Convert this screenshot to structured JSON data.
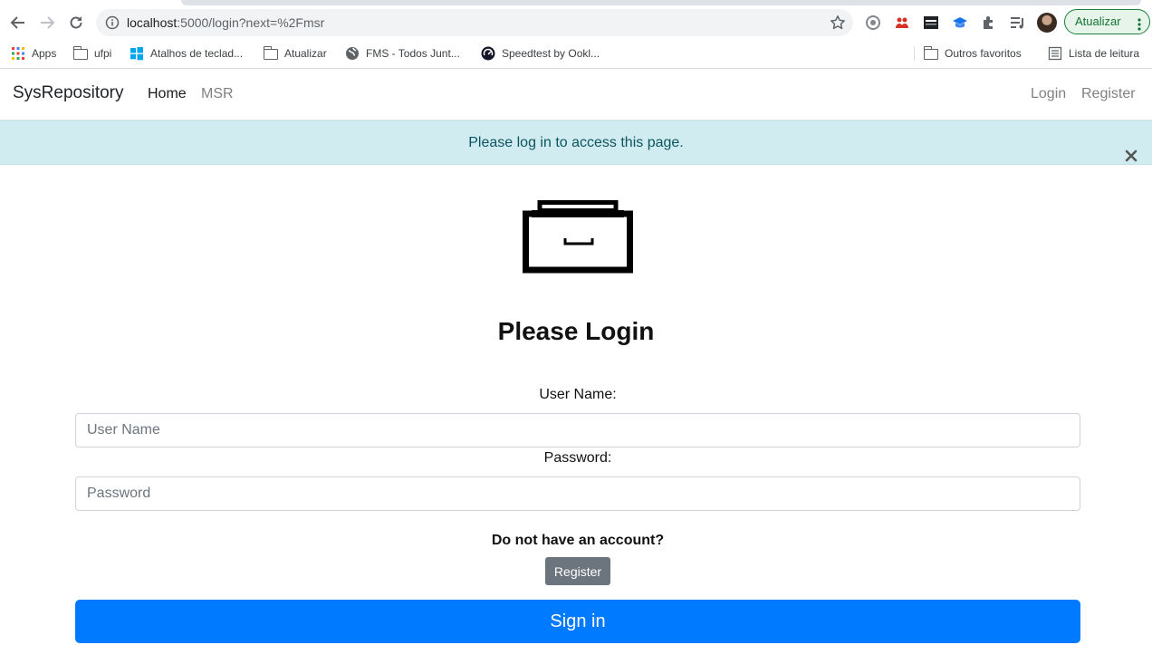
{
  "browser": {
    "url_host": "localhost",
    "url_rest": ":5000/login?next=%2Fmsr",
    "update_label": "Atualizar",
    "bookmarks": [
      {
        "label": "Apps",
        "icon": "apps-grid-icon"
      },
      {
        "label": "ufpi",
        "icon": "folder-icon"
      },
      {
        "label": "Atalhos de teclad...",
        "icon": "windows-logo-icon"
      },
      {
        "label": "Atualizar",
        "icon": "folder-icon"
      },
      {
        "label": "FMS - Todos Junt...",
        "icon": "globe-icon"
      },
      {
        "label": "Speedtest by Ookl...",
        "icon": "speedtest-icon"
      }
    ],
    "other_bookmarks": "Outros favoritos",
    "reading_list": "Lista de leitura"
  },
  "navbar": {
    "brand": "SysRepository",
    "links": [
      "Home",
      "MSR"
    ],
    "login": "Login",
    "register": "Register"
  },
  "alert": {
    "message": "Please log in to access this page."
  },
  "login": {
    "title": "Please Login",
    "username_label": "User Name:",
    "username_placeholder": "User Name",
    "password_label": "Password:",
    "password_placeholder": "Password",
    "no_account": "Do not have an account?",
    "register_button": "Register",
    "signin_button": "Sign in"
  },
  "colors": {
    "primary": "#007bff",
    "secondary": "#6c757d",
    "alert_bg": "#d1ecf1",
    "alert_text": "#0c5460"
  }
}
